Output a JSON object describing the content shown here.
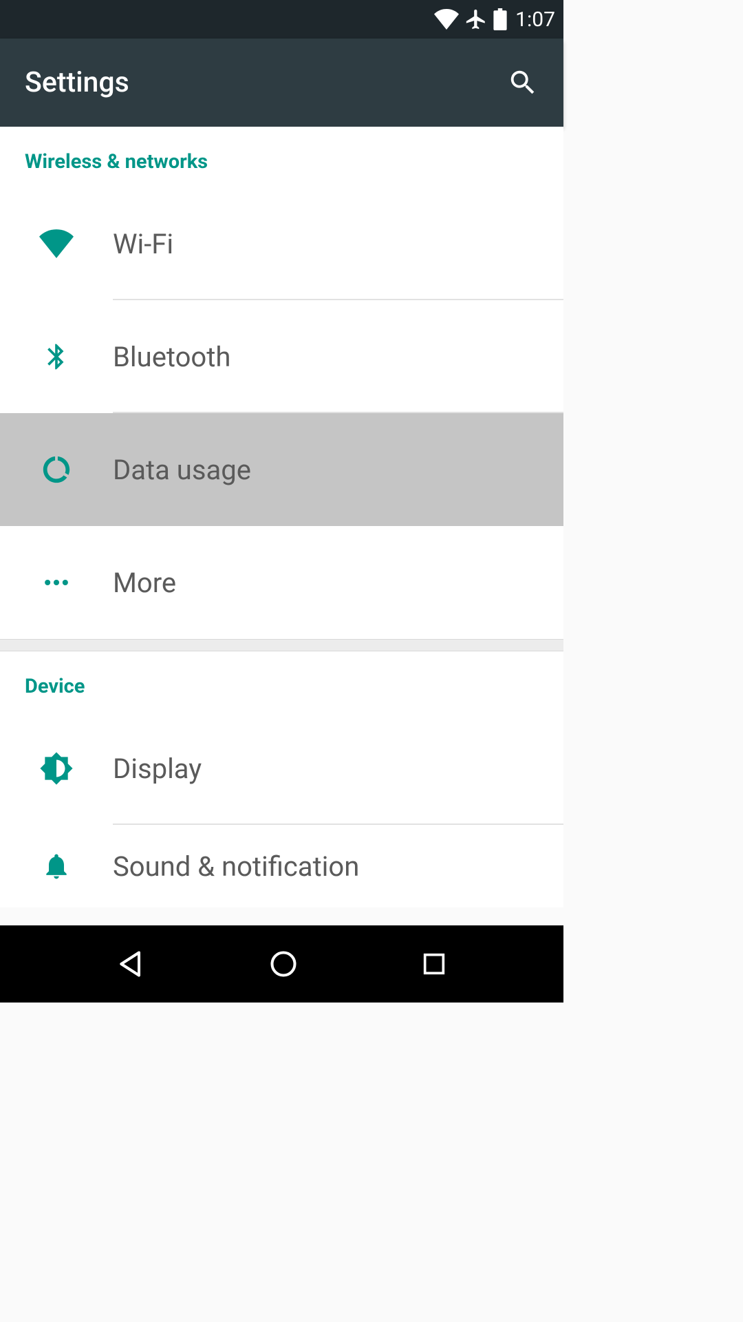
{
  "status": {
    "time": "1:07"
  },
  "header": {
    "title": "Settings"
  },
  "sections": {
    "wireless": {
      "title": "Wireless & networks",
      "wifi": "Wi-Fi",
      "bluetooth": "Bluetooth",
      "data_usage": "Data usage",
      "more": "More"
    },
    "device": {
      "title": "Device",
      "display": "Display",
      "sound": "Sound & notification"
    }
  },
  "colors": {
    "accent": "#009688",
    "toolbar": "#2e3c42",
    "statusbar": "#1e272c"
  }
}
